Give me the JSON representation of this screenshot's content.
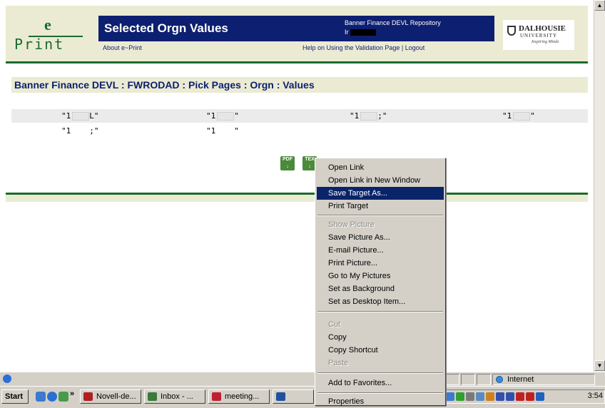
{
  "header": {
    "logo_e": "e",
    "logo_print": "Print",
    "title": "Selected Orgn Values",
    "repository": "Banner Finance DEVL Repository",
    "user_prefix": "Ir",
    "about_link": "About e~Print",
    "help_link": "Help on Using the Validation Page | Logout",
    "university_name": "DALHOUSIE",
    "university_sub": "UNIVERSITY",
    "university_tagline": "Inspiring Minds"
  },
  "breadcrumb": "Banner Finance DEVL : FWRODAD : Pick Pages : Orgn : Values",
  "values": {
    "row1": [
      {
        "pre": "\"1",
        "post": "L\""
      },
      {
        "pre": "\"1",
        "post": "\""
      },
      {
        "pre": "\"1",
        "post": ";\""
      },
      {
        "pre": "\"1",
        "post": "\""
      }
    ],
    "row2": [
      {
        "pre": "\"1",
        "post": ";\""
      },
      {
        "pre": "\"1",
        "post": "\""
      }
    ]
  },
  "export": {
    "pdf_label": "PDF",
    "text_label": "TEX"
  },
  "context_menu": {
    "open_link": "Open Link",
    "open_new_window": "Open Link in New Window",
    "save_target": "Save Target As...",
    "print_target": "Print Target",
    "show_picture": "Show Picture",
    "save_picture": "Save Picture As...",
    "email_picture": "E-mail Picture...",
    "print_picture": "Print Picture...",
    "go_to_pictures": "Go to My Pictures",
    "set_background": "Set as Background",
    "set_desktop_item": "Set as Desktop Item...",
    "cut": "Cut",
    "copy": "Copy",
    "copy_shortcut": "Copy Shortcut",
    "paste": "Paste",
    "add_favorites": "Add to Favorites...",
    "properties": "Properties"
  },
  "statusbar": {
    "zone": "Internet"
  },
  "taskbar": {
    "start": "Start",
    "chevron": "»",
    "buttons": [
      "Novell-de...",
      "Inbox - ...",
      "meeting...",
      ""
    ],
    "clock": "3:54"
  },
  "colors": {
    "title_bar": "#0d1f70",
    "brand_green": "#1b6b2e",
    "header_bg": "#ebebd3",
    "menu_highlight": "#0a246a"
  }
}
